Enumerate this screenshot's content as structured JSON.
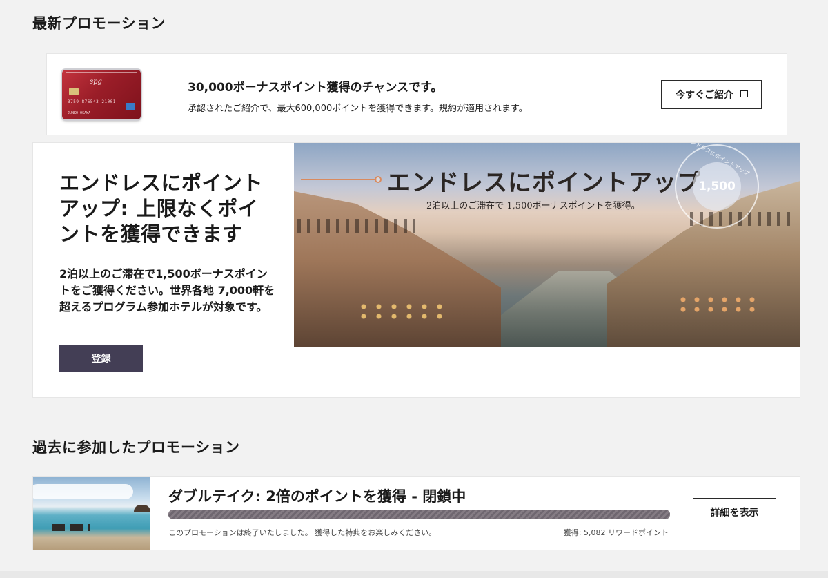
{
  "sections": {
    "latest_title": "最新プロモーション",
    "past_title": "過去に参加したプロモーション"
  },
  "referral": {
    "headline": "30,000ボーナスポイント獲得のチャンスです。",
    "subtext": "承認されたご紹介で、最大600,000ポイントを獲得できます。規約が適用されます。",
    "button_label": "今すぐご紹介",
    "card": {
      "logo": "spg",
      "number": "3759 876543 21001",
      "holder": "JUNKO OSAWA"
    }
  },
  "promo": {
    "title": "エンドレスにポイントアップ: 上限なくポイントを獲得できます",
    "description": "2泊以上のご滞在で1,500ボーナスポイントをご獲得ください。世界各地 7,000軒を超えるプログラム参加ホテルが対象です。",
    "button_label": "登録",
    "banner": {
      "title": "エンドレスにポイントアップ",
      "subtitle": "2泊以上のご滞在で 1,500ボーナスポイントを獲得。",
      "badge_value": "1,500",
      "badge_text": "エンドレスにポイントアップ"
    }
  },
  "past": {
    "title": "ダブルテイク: 2倍のポイントを獲得 - 閉鎖中",
    "progress": 1.0,
    "note": "このプロモーションは終了いたしました。 獲得した特典をお楽しみください。",
    "earned": "獲得: 5,082 リワードポイント",
    "button_label": "詳細を表示"
  },
  "colors": {
    "primary_button": "#433e55",
    "accent_line": "#d98a5e",
    "page_bg": "#f2f2f2"
  },
  "icons": {
    "external_link": "external-link-icon"
  }
}
